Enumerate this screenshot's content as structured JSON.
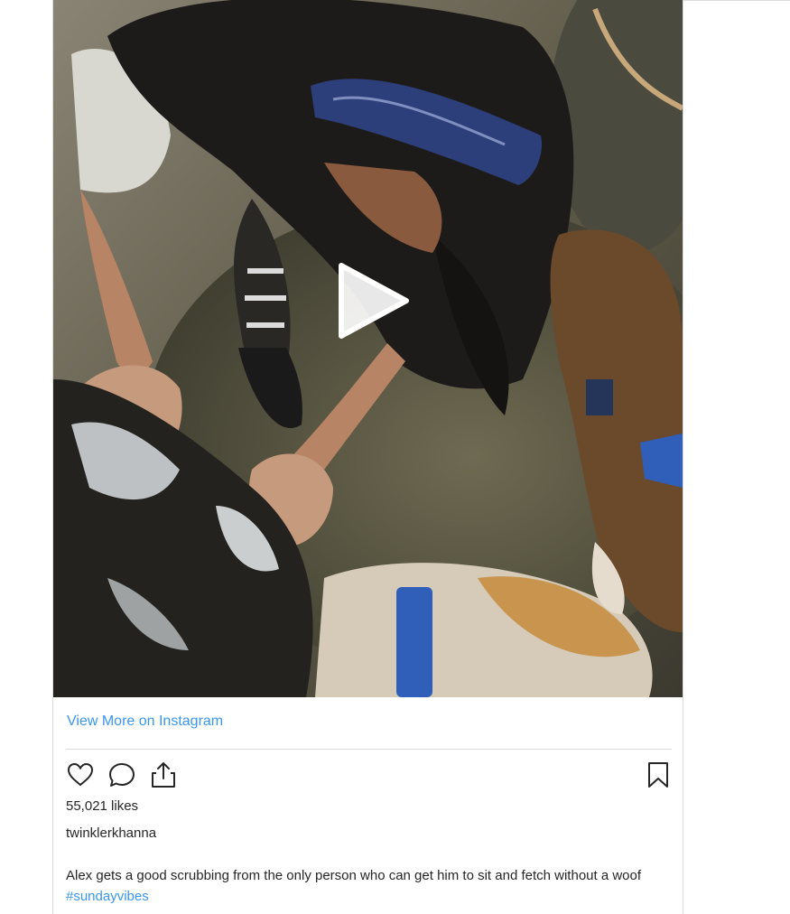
{
  "post": {
    "view_more_label": "View More on Instagram",
    "likes_text": "55,021 likes",
    "username": "twinklerkhanna",
    "caption_text": "Alex gets a good scrubbing from the only person who can get him to sit and fetch without a woof ",
    "hashtag": "#sundayvibes"
  },
  "icons": {
    "play": "play-icon",
    "like": "heart-icon",
    "comment": "comment-bubble-icon",
    "share": "share-icon",
    "save": "bookmark-icon"
  },
  "colors": {
    "link": "#3897f0",
    "text": "#262626",
    "border": "#dbdbdb"
  }
}
